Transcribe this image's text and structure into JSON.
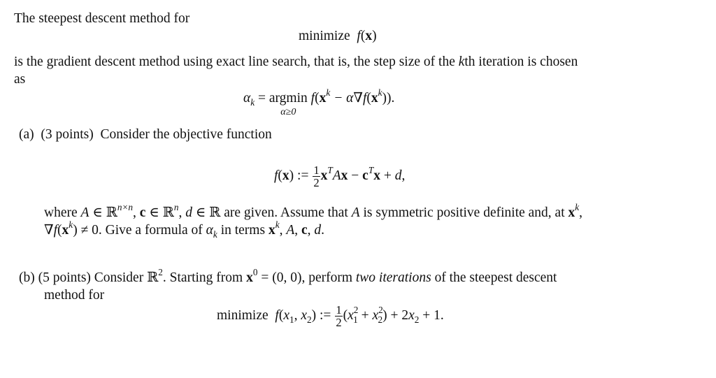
{
  "intro": {
    "line1": "The steepest descent method for",
    "display1": {
      "word": "minimize",
      "expr": "f(x)"
    },
    "line2": "is the gradient descent method using exact line search, that is, the step size of the kth iteration is chosen",
    "line2_parts": {
      "before": "is the gradient descent method using exact line search, that is, the step size of the ",
      "k": "k",
      "after": "th iteration is chosen"
    },
    "line3": "as",
    "display2": {
      "lhs": "α",
      "lhs_sub": "k",
      "eq": "=",
      "op": "argmin",
      "op_under": "α≥0",
      "rhs_f": "f",
      "rhs_open": "(",
      "x": "x",
      "sup_k": "k",
      "minus": " − α∇",
      "f2": "f",
      "open2": "(",
      "x2": "x",
      "sup_k2": "k",
      "close": ")).",
      "full": "α_k = argmin_{α≥0} f(x^k − α∇f(x^k))."
    }
  },
  "part_a": {
    "label": "(a)",
    "points": "(3 points)",
    "text": "Consider the objective function",
    "formula": {
      "lhs": "f(x) :=",
      "frac_num": "1",
      "frac_den": "2",
      "full": "f(x) := ½ xᵀAx − cᵀx + d,"
    },
    "body_line1": "where A ∈ ℝ^{n×n}, c ∈ ℝ^n, d ∈ ℝ are given. Assume that A is symmetric positive definite and, at x^k,",
    "body_line2": "∇f(x^k) ≠ 0. Give a formula of α_k in terms x^k, A, c, d."
  },
  "part_b": {
    "label": "(b)",
    "points": "(5 points)",
    "text_line1": "Consider ℝ². Starting from x⁰ = (0, 0), perform two iterations of the steepest descent",
    "emphasis": "two iterations",
    "text_line2": "method for",
    "formula": {
      "word": "minimize",
      "frac_num": "1",
      "frac_den": "2",
      "full": "minimize f(x₁, x₂) := ½(x₁² + x₂²) + 2x₂ + 1."
    }
  }
}
